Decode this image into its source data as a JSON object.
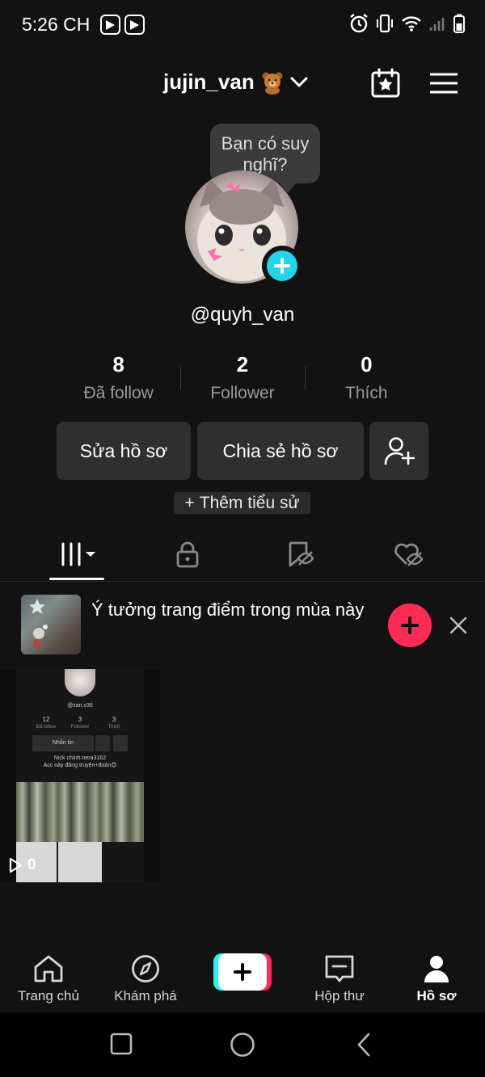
{
  "status_bar": {
    "time": "5:26 CH"
  },
  "header": {
    "username": "jujin_van",
    "icons": [
      "bear-emoji-icon",
      "chevron-down-icon",
      "calendar-star-icon",
      "menu-icon"
    ]
  },
  "tooltip": {
    "text": "Bạn có suy nghĩ?"
  },
  "profile": {
    "handle": "@quyh_van",
    "stats": [
      {
        "value": "8",
        "label": "Đã follow"
      },
      {
        "value": "2",
        "label": "Follower"
      },
      {
        "value": "0",
        "label": "Thích"
      }
    ],
    "edit_label": "Sửa hồ sơ",
    "share_label": "Chia sẻ hồ sơ",
    "add_bio_label": "Thêm tiểu sử"
  },
  "tabs": [
    {
      "name": "videos",
      "icon": "grid-icon",
      "active": true
    },
    {
      "name": "private",
      "icon": "lock-icon"
    },
    {
      "name": "saved",
      "icon": "bookmark-hidden-icon"
    },
    {
      "name": "liked",
      "icon": "heart-hidden-icon"
    }
  ],
  "suggestion": {
    "text": "Ý tưởng trang điểm trong mùa này"
  },
  "videos": [
    {
      "views": "0",
      "thumb": {
        "handle": "@zan.v36",
        "stats": [
          {
            "value": "12",
            "label": "Đã follow"
          },
          {
            "value": "3",
            "label": "Follower"
          },
          {
            "value": "3",
            "label": "Thích"
          }
        ],
        "message_label": "Nhắn tin",
        "bio_line1": "Nick chính:nera3162",
        "bio_line2": "Acc này đăng truyện+đoản😊"
      }
    }
  ],
  "bottom_nav": {
    "items": [
      {
        "label": "Trang chủ",
        "icon": "home-icon"
      },
      {
        "label": "Khám phá",
        "icon": "compass-icon"
      },
      {
        "label": "Hộp thư",
        "icon": "inbox-icon"
      },
      {
        "label": "Hồ sơ",
        "icon": "profile-icon",
        "active": true
      }
    ]
  },
  "colors": {
    "background": "#121212",
    "accent_cyan": "#20d5ec",
    "accent_red": "#fe2c55",
    "button_bg": "#2f2f2f"
  }
}
